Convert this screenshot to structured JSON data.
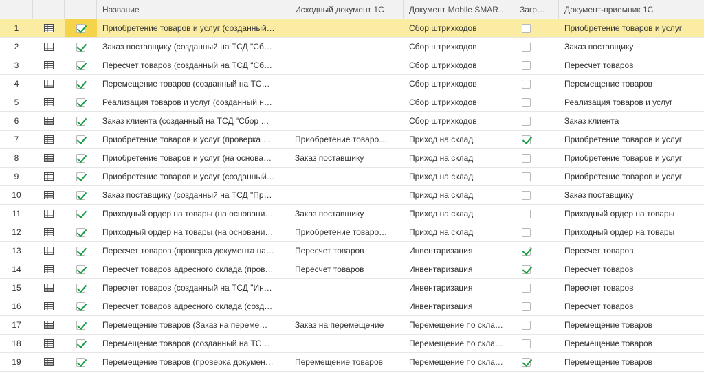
{
  "columns": {
    "num": "",
    "icon": "",
    "check": "",
    "name": "Название",
    "source_doc": "Исходный документ 1С",
    "mobile_doc": "Документ Mobile SMAR…",
    "load": "Загр…",
    "target_doc": "Документ-приемник 1С"
  },
  "icons": {
    "row_icon": "table-icon",
    "check_icon": "checkbox-icon"
  },
  "colors": {
    "selected_row": "#fbeca3",
    "selected_cell": "#f5d44c",
    "check": "#1a9c47"
  },
  "rows": [
    {
      "num": "1",
      "checked": true,
      "name": "Приобретение товаров и услуг (созданный…",
      "source": "",
      "mobile": "Сбор штрихкодов",
      "load": false,
      "target": "Приобретение товаров и услуг",
      "selected": true
    },
    {
      "num": "2",
      "checked": true,
      "name": "Заказ поставщику (созданный на ТСД \"Сб…",
      "source": "",
      "mobile": "Сбор штрихкодов",
      "load": false,
      "target": "Заказ поставщику",
      "selected": false
    },
    {
      "num": "3",
      "checked": true,
      "name": "Пересчет товаров (созданный на ТСД \"Сб…",
      "source": "",
      "mobile": "Сбор штрихкодов",
      "load": false,
      "target": "Пересчет товаров",
      "selected": false
    },
    {
      "num": "4",
      "checked": true,
      "name": "Перемещение товаров (созданный на ТС…",
      "source": "",
      "mobile": "Сбор штрихкодов",
      "load": false,
      "target": "Перемещение товаров",
      "selected": false
    },
    {
      "num": "5",
      "checked": true,
      "name": "Реализация товаров и услуг (созданный н…",
      "source": "",
      "mobile": "Сбор штрихкодов",
      "load": false,
      "target": "Реализация товаров и услуг",
      "selected": false
    },
    {
      "num": "6",
      "checked": true,
      "name": "Заказ клиента (созданный на ТСД \"Сбор …",
      "source": "",
      "mobile": "Сбор штрихкодов",
      "load": false,
      "target": "Заказ клиента",
      "selected": false
    },
    {
      "num": "7",
      "checked": true,
      "name": "Приобретение товаров и услуг (проверка …",
      "source": "Приобретение товаро…",
      "mobile": "Приход на склад",
      "load": true,
      "target": "Приобретение товаров и услуг",
      "selected": false
    },
    {
      "num": "8",
      "checked": true,
      "name": "Приобретение товаров и услуг (на основа…",
      "source": "Заказ поставщику",
      "mobile": "Приход на склад",
      "load": false,
      "target": "Приобретение товаров и услуг",
      "selected": false
    },
    {
      "num": "9",
      "checked": true,
      "name": "Приобретение товаров и услуг (созданный…",
      "source": "",
      "mobile": "Приход на склад",
      "load": false,
      "target": "Приобретение товаров и услуг",
      "selected": false
    },
    {
      "num": "10",
      "checked": true,
      "name": "Заказ поставщику (созданный на ТСД \"Пр…",
      "source": "",
      "mobile": "Приход на склад",
      "load": false,
      "target": "Заказ поставщику",
      "selected": false
    },
    {
      "num": "11",
      "checked": true,
      "name": "Приходный ордер на товары (на основани…",
      "source": "Заказ поставщику",
      "mobile": "Приход на склад",
      "load": false,
      "target": "Приходный ордер на товары",
      "selected": false
    },
    {
      "num": "12",
      "checked": true,
      "name": "Приходный ордер на товары (на основани…",
      "source": "Приобретение товаро…",
      "mobile": "Приход на склад",
      "load": false,
      "target": "Приходный ордер на товары",
      "selected": false
    },
    {
      "num": "13",
      "checked": true,
      "name": "Пересчет товаров (проверка документа на…",
      "source": "Пересчет товаров",
      "mobile": "Инвентаризация",
      "load": true,
      "target": "Пересчет товаров",
      "selected": false
    },
    {
      "num": "14",
      "checked": true,
      "name": "Пересчет товаров адресного склада (пров…",
      "source": "Пересчет товаров",
      "mobile": "Инвентаризация",
      "load": true,
      "target": "Пересчет товаров",
      "selected": false
    },
    {
      "num": "15",
      "checked": true,
      "name": "Пересчет товаров (созданный на ТСД \"Ин…",
      "source": "",
      "mobile": "Инвентаризация",
      "load": false,
      "target": "Пересчет товаров",
      "selected": false
    },
    {
      "num": "16",
      "checked": true,
      "name": "Пересчет товаров адресного склада (созд…",
      "source": "",
      "mobile": "Инвентаризация",
      "load": false,
      "target": "Пересчет товаров",
      "selected": false
    },
    {
      "num": "17",
      "checked": true,
      "name": "Перемещение товаров (Заказ на переме…",
      "source": "Заказ на перемещение",
      "mobile": "Перемещение по скла…",
      "load": false,
      "target": "Перемещение товаров",
      "selected": false
    },
    {
      "num": "18",
      "checked": true,
      "name": "Перемещение товаров (созданный на ТС…",
      "source": "",
      "mobile": "Перемещение по скла…",
      "load": false,
      "target": "Перемещение товаров",
      "selected": false
    },
    {
      "num": "19",
      "checked": true,
      "name": "Перемещение товаров (проверка докумен…",
      "source": "Перемещение товаров",
      "mobile": "Перемещение по скла…",
      "load": true,
      "target": "Перемещение товаров",
      "selected": false
    }
  ]
}
